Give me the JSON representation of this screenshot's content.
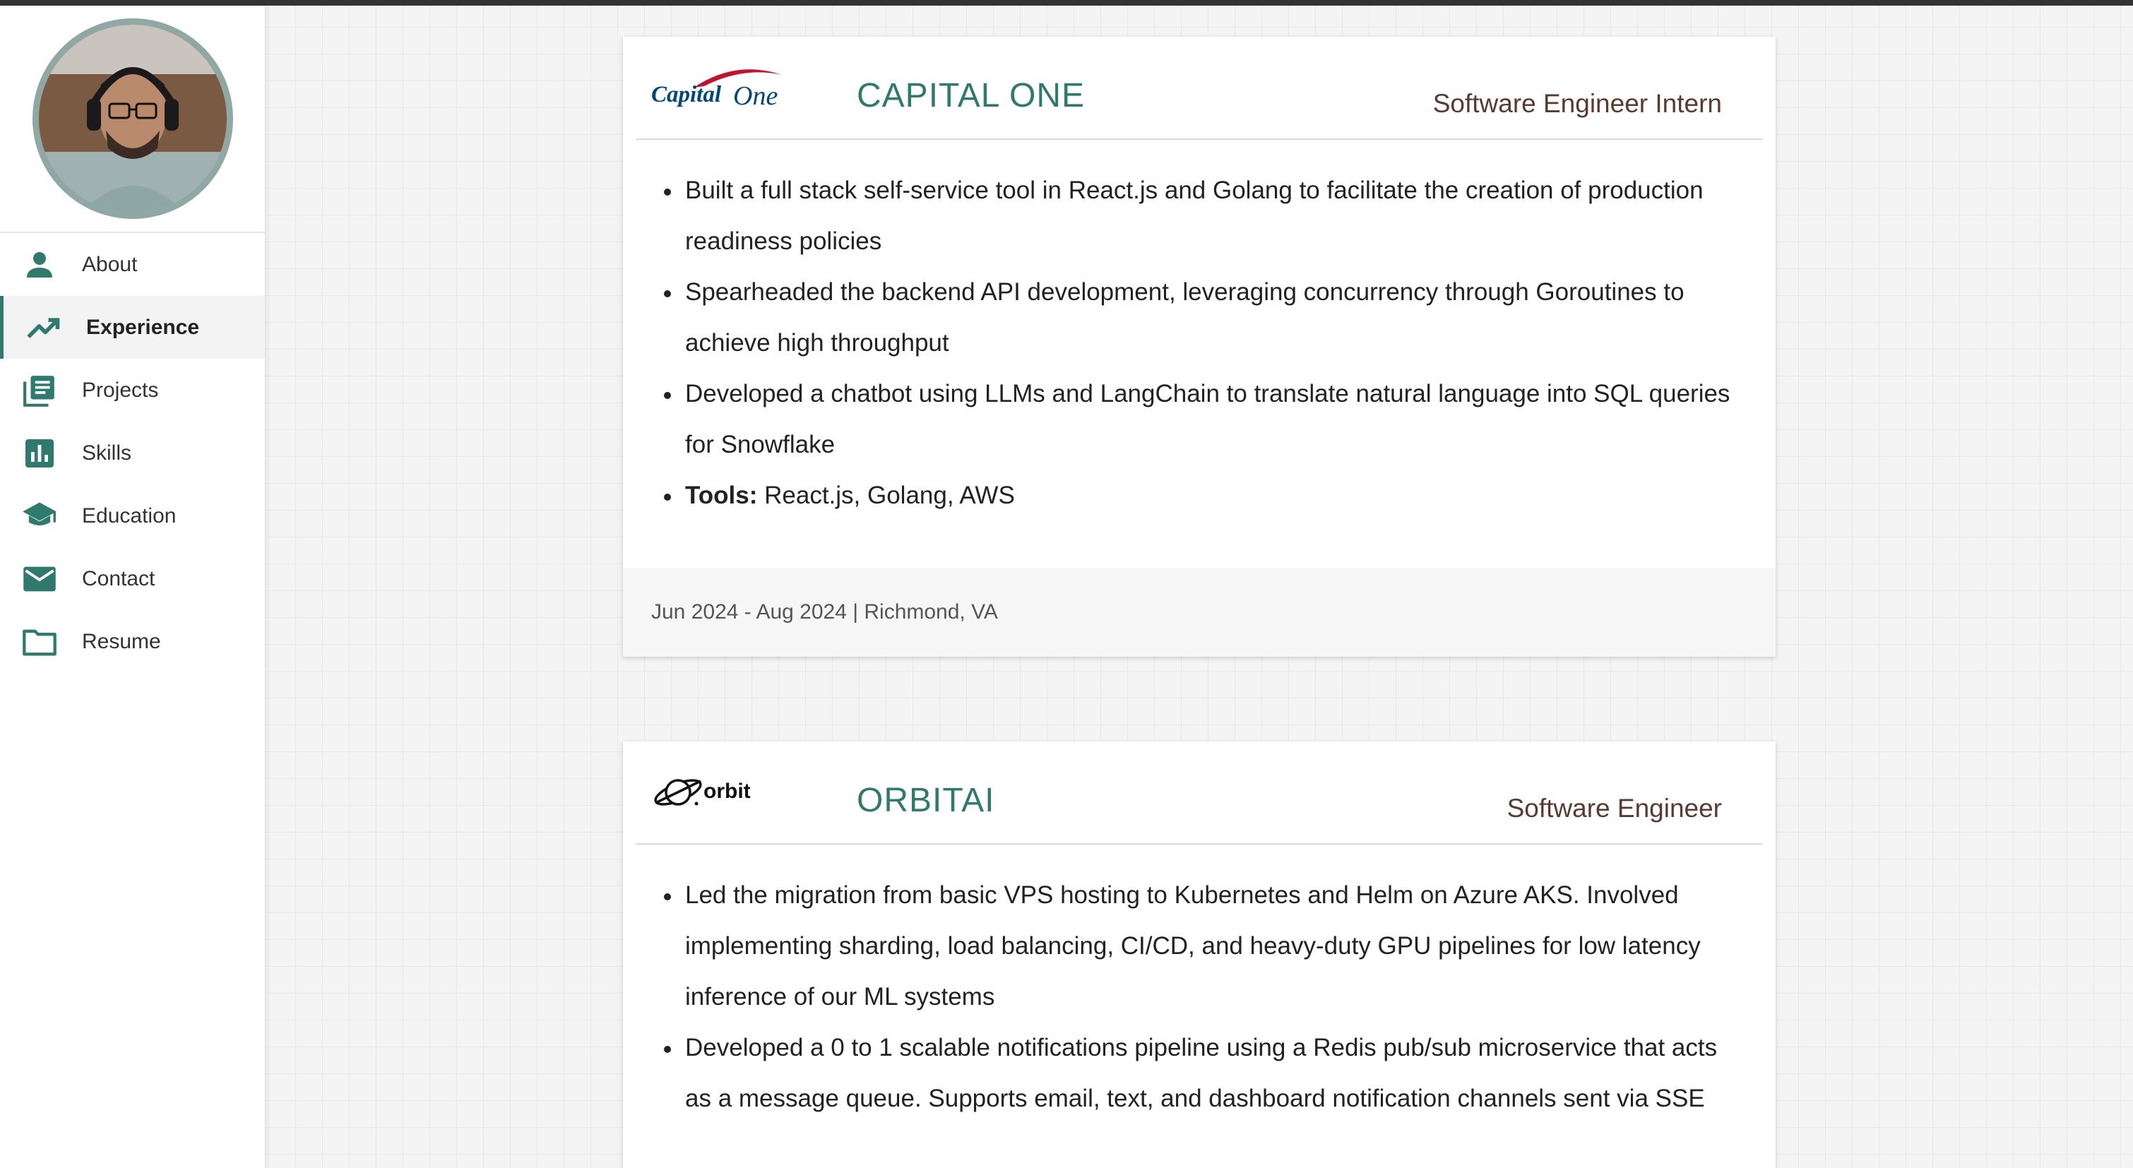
{
  "sidebar": {
    "items": [
      {
        "label": "About",
        "icon": "person-icon"
      },
      {
        "label": "Experience",
        "icon": "trending-up-icon",
        "active": true
      },
      {
        "label": "Projects",
        "icon": "library-icon"
      },
      {
        "label": "Skills",
        "icon": "bar-chart-icon"
      },
      {
        "label": "Education",
        "icon": "graduation-cap-icon"
      },
      {
        "label": "Contact",
        "icon": "mail-icon"
      },
      {
        "label": "Resume",
        "icon": "folder-icon"
      }
    ]
  },
  "colors": {
    "accent": "#2e7b6e",
    "role_text": "#5a3a2e",
    "capital_one_red": "#c8102e",
    "capital_one_navy": "#004879"
  },
  "experience": [
    {
      "logo_text": {
        "part1": "Capital",
        "part2": "One"
      },
      "company": "CAPITAL ONE",
      "role": "Software Engineer Intern",
      "bullets": [
        "Built a full stack self-service tool in React.js and Golang to facilitate the creation of production readiness policies",
        "Spearheaded the backend API development, leveraging concurrency through Goroutines to achieve high throughput",
        "Developed a chatbot using LLMs and LangChain to translate natural language into SQL queries for Snowflake"
      ],
      "tools_label": "Tools:",
      "tools": " React.js, Golang, AWS",
      "footer": "Jun 2024 - Aug 2024 | Richmond, VA"
    },
    {
      "logo_text": "orbit",
      "company": "ORBITAI",
      "role": "Software Engineer",
      "bullets": [
        "Led the migration from basic VPS hosting to Kubernetes and Helm on Azure AKS. Involved implementing sharding, load balancing, CI/CD, and heavy-duty GPU pipelines for low latency inference of our ML systems",
        "Developed a 0 to 1 scalable notifications pipeline using a Redis pub/sub microservice that acts as a message queue. Supports email, text, and dashboard notification channels sent via SSE"
      ]
    }
  ]
}
